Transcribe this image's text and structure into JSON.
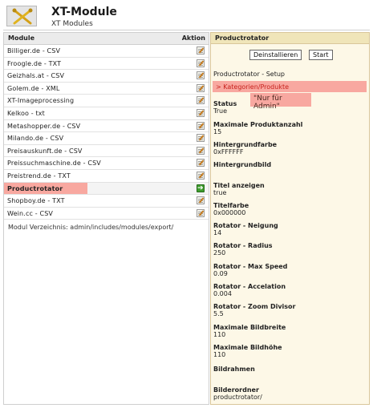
{
  "header": {
    "title": "XT-Module",
    "subtitle": "XT Modules",
    "logo_icon": "tools-icon"
  },
  "module_list": {
    "col_module": "Module",
    "col_action": "Aktion",
    "items": [
      {
        "label": "Billiger.de - CSV",
        "icon": "edit-icon"
      },
      {
        "label": "Froogle.de - TXT",
        "icon": "edit-icon"
      },
      {
        "label": "Geizhals.at - CSV",
        "icon": "edit-icon"
      },
      {
        "label": "Golem.de - XML",
        "icon": "edit-icon"
      },
      {
        "label": "XT-Imageprocessing",
        "icon": "edit-icon"
      },
      {
        "label": "Kelkoo - txt",
        "icon": "edit-icon"
      },
      {
        "label": "Metashopper.de - CSV",
        "icon": "edit-icon"
      },
      {
        "label": "Milando.de - CSV",
        "icon": "edit-icon"
      },
      {
        "label": "Preisauskunft.de - CSV",
        "icon": "edit-icon"
      },
      {
        "label": "Preissuchmaschine.de - CSV",
        "icon": "edit-icon"
      },
      {
        "label": "Preistrend.de - TXT",
        "icon": "edit-icon"
      },
      {
        "label": "Productrotator",
        "icon": "arrow-right-icon",
        "active": true
      },
      {
        "label": "Shopboy.de - TXT",
        "icon": "edit-icon"
      },
      {
        "label": "Wein.cc - CSV",
        "icon": "edit-icon"
      }
    ],
    "directory_line": "Modul Verzeichnis: admin/includes/modules/export/"
  },
  "details": {
    "title": "Productrotator",
    "uninstall_label": "Deinstallieren",
    "start_label": "Start",
    "setup_line": "Productrotator - Setup",
    "category_link": "> Kategorien/Produkte",
    "admin_note": "\"Nur für Admin\"",
    "fields": [
      {
        "label": "Status",
        "value": "True"
      },
      {
        "label": "Maximale Produktanzahl",
        "value": "15"
      },
      {
        "label": "Hintergrundfarbe",
        "value": "0xFFFFFF"
      },
      {
        "label": "Hintergrundbild",
        "value": ""
      },
      {
        "label": "Titel anzeigen",
        "value": "true"
      },
      {
        "label": "Titelfarbe",
        "value": "0x000000"
      },
      {
        "label": "Rotator - Neigung",
        "value": "14"
      },
      {
        "label": "Rotator - Radius",
        "value": "250"
      },
      {
        "label": "Rotator - Max Speed",
        "value": "0.09"
      },
      {
        "label": "Rotator - Accelation",
        "value": "0.004"
      },
      {
        "label": "Rotator - Zoom Divisor",
        "value": "5.5"
      },
      {
        "label": "Maximale Bildbreite",
        "value": "110"
      },
      {
        "label": "Maximale Bildhöhe",
        "value": "110"
      },
      {
        "label": "Bildrahmen",
        "value": ""
      },
      {
        "label": "Bilderordner",
        "value": "productrotator/"
      }
    ]
  },
  "colors": {
    "highlight": "#f8a8a0",
    "panel_bg": "#fdf8e7",
    "panel_header": "#f0e5b9",
    "link": "#c8231e"
  }
}
